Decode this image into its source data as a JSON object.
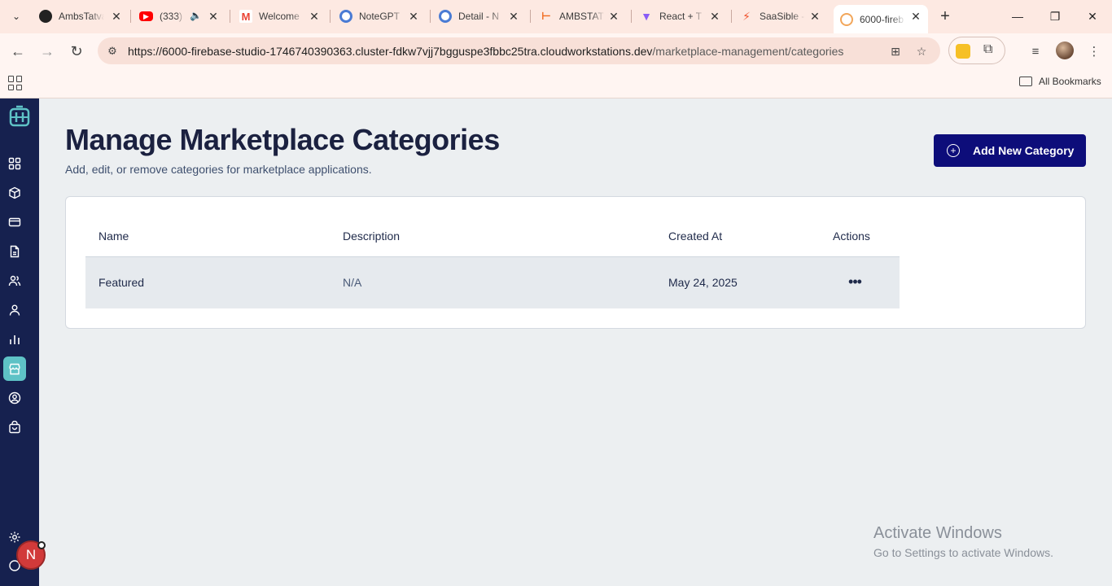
{
  "browser": {
    "tabs": [
      {
        "title": "AmbsTatva",
        "favicon_color": "#222222"
      },
      {
        "title": "(333)",
        "favicon_color": "#ff0000"
      },
      {
        "title": "Welcome",
        "favicon_color": "#ea4335"
      },
      {
        "title": "NoteGPT",
        "favicon_color": "#4a7bd4"
      },
      {
        "title": "Detail - N",
        "favicon_color": "#4a7bd4"
      },
      {
        "title": "AMBSTAT",
        "favicon_color": "#f06a1c"
      },
      {
        "title": "React + T",
        "favicon_color": "#8a5cf6"
      },
      {
        "title": "SaaSible -",
        "favicon_color": "#f0522c"
      },
      {
        "title": "6000-fireb",
        "favicon_color": "#f2a65a"
      }
    ],
    "url_main": "https://6000-firebase-studio-1746740390363.cluster-fdkw7vjj7bgguspe3fbbc25tra.cloudworkstations.dev",
    "url_path": "/marketplace-management/categories",
    "all_bookmarks_label": "All Bookmarks"
  },
  "app": {
    "accent_color": "#5ec2c6",
    "sidebar_color": "#16214f",
    "primary_button_color": "#0d0d7a",
    "page_title": "Manage Marketplace Categories",
    "page_subtitle": "Add, edit, or remove categories for marketplace applications.",
    "add_button_label": "Add New Category",
    "table": {
      "headers": [
        "Name",
        "Description",
        "Created At",
        "Actions"
      ],
      "rows": [
        {
          "name": "Featured",
          "description": "N/A",
          "created_at": "May 24, 2025"
        }
      ]
    },
    "user_avatar_initial": "N"
  },
  "watermark": {
    "line1": "Activate Windows",
    "line2": "Go to Settings to activate Windows."
  }
}
